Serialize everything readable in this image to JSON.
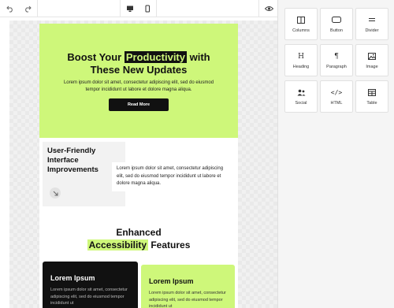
{
  "hero": {
    "title_part1": "Boost Your",
    "title_highlight": "Productivity",
    "title_part2": "with",
    "title_line2": "These New Updates",
    "subtitle": "Lorem ipsum dolor sit amet, consectetur adipiscing elit, sed do eiusmod tempor incididunt ut labore et dolore magna aliqua.",
    "button": "Read More"
  },
  "feature": {
    "title": "User-Friendly Interface Improvements",
    "text": "Lorem ipsum dolor sit amet, consectetur adipiscing elit, sed do eiusmod tempor incididunt ut labore et dolore magna aliqua."
  },
  "section": {
    "title_line1": "Enhanced",
    "title_highlight": "Accessibility",
    "title_rest": "Features"
  },
  "cards": [
    {
      "title": "Lorem Ipsum",
      "text": "Lorem ipsum dolor sit amet, consectetur adipiscing elit, sed do eiusmod tempor incididunt ut"
    },
    {
      "title": "Lorem Ipsum",
      "text": "Lorem ipsum dolor sit amet, consectetur adipiscing elit, sed do eiusmod tempor incididunt ut"
    }
  ],
  "blocks": [
    {
      "label": "Columns",
      "icon": "columns-icon"
    },
    {
      "label": "Button",
      "icon": "button-icon"
    },
    {
      "label": "Divider",
      "icon": "divider-icon"
    },
    {
      "label": "Heading",
      "icon": "heading-icon",
      "glyph": "H"
    },
    {
      "label": "Paragraph",
      "icon": "paragraph-icon",
      "glyph": "¶"
    },
    {
      "label": "Image",
      "icon": "image-icon"
    },
    {
      "label": "Social",
      "icon": "social-icon"
    },
    {
      "label": "HTML",
      "icon": "code-icon",
      "glyph": "</>"
    },
    {
      "label": "Table",
      "icon": "table-icon"
    }
  ],
  "colors": {
    "accent": "#cef77a",
    "dark": "#111111"
  }
}
